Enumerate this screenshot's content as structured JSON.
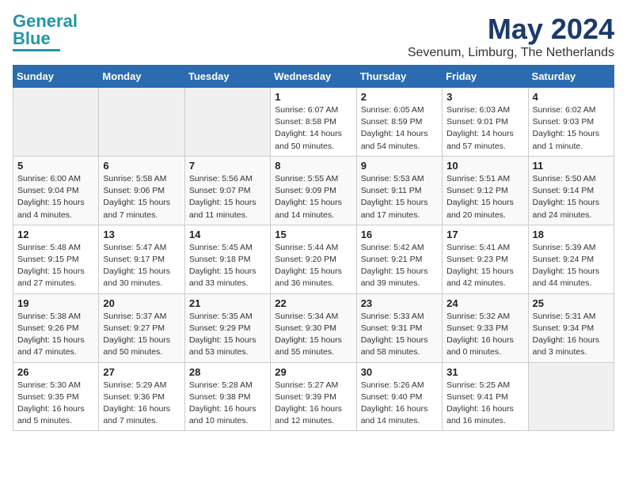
{
  "logo": {
    "line1": "General",
    "line2": "Blue"
  },
  "title": "May 2024",
  "subtitle": "Sevenum, Limburg, The Netherlands",
  "weekdays": [
    "Sunday",
    "Monday",
    "Tuesday",
    "Wednesday",
    "Thursday",
    "Friday",
    "Saturday"
  ],
  "weeks": [
    [
      {
        "day": "",
        "info": ""
      },
      {
        "day": "",
        "info": ""
      },
      {
        "day": "",
        "info": ""
      },
      {
        "day": "1",
        "info": "Sunrise: 6:07 AM\nSunset: 8:58 PM\nDaylight: 14 hours\nand 50 minutes."
      },
      {
        "day": "2",
        "info": "Sunrise: 6:05 AM\nSunset: 8:59 PM\nDaylight: 14 hours\nand 54 minutes."
      },
      {
        "day": "3",
        "info": "Sunrise: 6:03 AM\nSunset: 9:01 PM\nDaylight: 14 hours\nand 57 minutes."
      },
      {
        "day": "4",
        "info": "Sunrise: 6:02 AM\nSunset: 9:03 PM\nDaylight: 15 hours\nand 1 minute."
      }
    ],
    [
      {
        "day": "5",
        "info": "Sunrise: 6:00 AM\nSunset: 9:04 PM\nDaylight: 15 hours\nand 4 minutes."
      },
      {
        "day": "6",
        "info": "Sunrise: 5:58 AM\nSunset: 9:06 PM\nDaylight: 15 hours\nand 7 minutes."
      },
      {
        "day": "7",
        "info": "Sunrise: 5:56 AM\nSunset: 9:07 PM\nDaylight: 15 hours\nand 11 minutes."
      },
      {
        "day": "8",
        "info": "Sunrise: 5:55 AM\nSunset: 9:09 PM\nDaylight: 15 hours\nand 14 minutes."
      },
      {
        "day": "9",
        "info": "Sunrise: 5:53 AM\nSunset: 9:11 PM\nDaylight: 15 hours\nand 17 minutes."
      },
      {
        "day": "10",
        "info": "Sunrise: 5:51 AM\nSunset: 9:12 PM\nDaylight: 15 hours\nand 20 minutes."
      },
      {
        "day": "11",
        "info": "Sunrise: 5:50 AM\nSunset: 9:14 PM\nDaylight: 15 hours\nand 24 minutes."
      }
    ],
    [
      {
        "day": "12",
        "info": "Sunrise: 5:48 AM\nSunset: 9:15 PM\nDaylight: 15 hours\nand 27 minutes."
      },
      {
        "day": "13",
        "info": "Sunrise: 5:47 AM\nSunset: 9:17 PM\nDaylight: 15 hours\nand 30 minutes."
      },
      {
        "day": "14",
        "info": "Sunrise: 5:45 AM\nSunset: 9:18 PM\nDaylight: 15 hours\nand 33 minutes."
      },
      {
        "day": "15",
        "info": "Sunrise: 5:44 AM\nSunset: 9:20 PM\nDaylight: 15 hours\nand 36 minutes."
      },
      {
        "day": "16",
        "info": "Sunrise: 5:42 AM\nSunset: 9:21 PM\nDaylight: 15 hours\nand 39 minutes."
      },
      {
        "day": "17",
        "info": "Sunrise: 5:41 AM\nSunset: 9:23 PM\nDaylight: 15 hours\nand 42 minutes."
      },
      {
        "day": "18",
        "info": "Sunrise: 5:39 AM\nSunset: 9:24 PM\nDaylight: 15 hours\nand 44 minutes."
      }
    ],
    [
      {
        "day": "19",
        "info": "Sunrise: 5:38 AM\nSunset: 9:26 PM\nDaylight: 15 hours\nand 47 minutes."
      },
      {
        "day": "20",
        "info": "Sunrise: 5:37 AM\nSunset: 9:27 PM\nDaylight: 15 hours\nand 50 minutes."
      },
      {
        "day": "21",
        "info": "Sunrise: 5:35 AM\nSunset: 9:29 PM\nDaylight: 15 hours\nand 53 minutes."
      },
      {
        "day": "22",
        "info": "Sunrise: 5:34 AM\nSunset: 9:30 PM\nDaylight: 15 hours\nand 55 minutes."
      },
      {
        "day": "23",
        "info": "Sunrise: 5:33 AM\nSunset: 9:31 PM\nDaylight: 15 hours\nand 58 minutes."
      },
      {
        "day": "24",
        "info": "Sunrise: 5:32 AM\nSunset: 9:33 PM\nDaylight: 16 hours\nand 0 minutes."
      },
      {
        "day": "25",
        "info": "Sunrise: 5:31 AM\nSunset: 9:34 PM\nDaylight: 16 hours\nand 3 minutes."
      }
    ],
    [
      {
        "day": "26",
        "info": "Sunrise: 5:30 AM\nSunset: 9:35 PM\nDaylight: 16 hours\nand 5 minutes."
      },
      {
        "day": "27",
        "info": "Sunrise: 5:29 AM\nSunset: 9:36 PM\nDaylight: 16 hours\nand 7 minutes."
      },
      {
        "day": "28",
        "info": "Sunrise: 5:28 AM\nSunset: 9:38 PM\nDaylight: 16 hours\nand 10 minutes."
      },
      {
        "day": "29",
        "info": "Sunrise: 5:27 AM\nSunset: 9:39 PM\nDaylight: 16 hours\nand 12 minutes."
      },
      {
        "day": "30",
        "info": "Sunrise: 5:26 AM\nSunset: 9:40 PM\nDaylight: 16 hours\nand 14 minutes."
      },
      {
        "day": "31",
        "info": "Sunrise: 5:25 AM\nSunset: 9:41 PM\nDaylight: 16 hours\nand 16 minutes."
      },
      {
        "day": "",
        "info": ""
      }
    ]
  ]
}
